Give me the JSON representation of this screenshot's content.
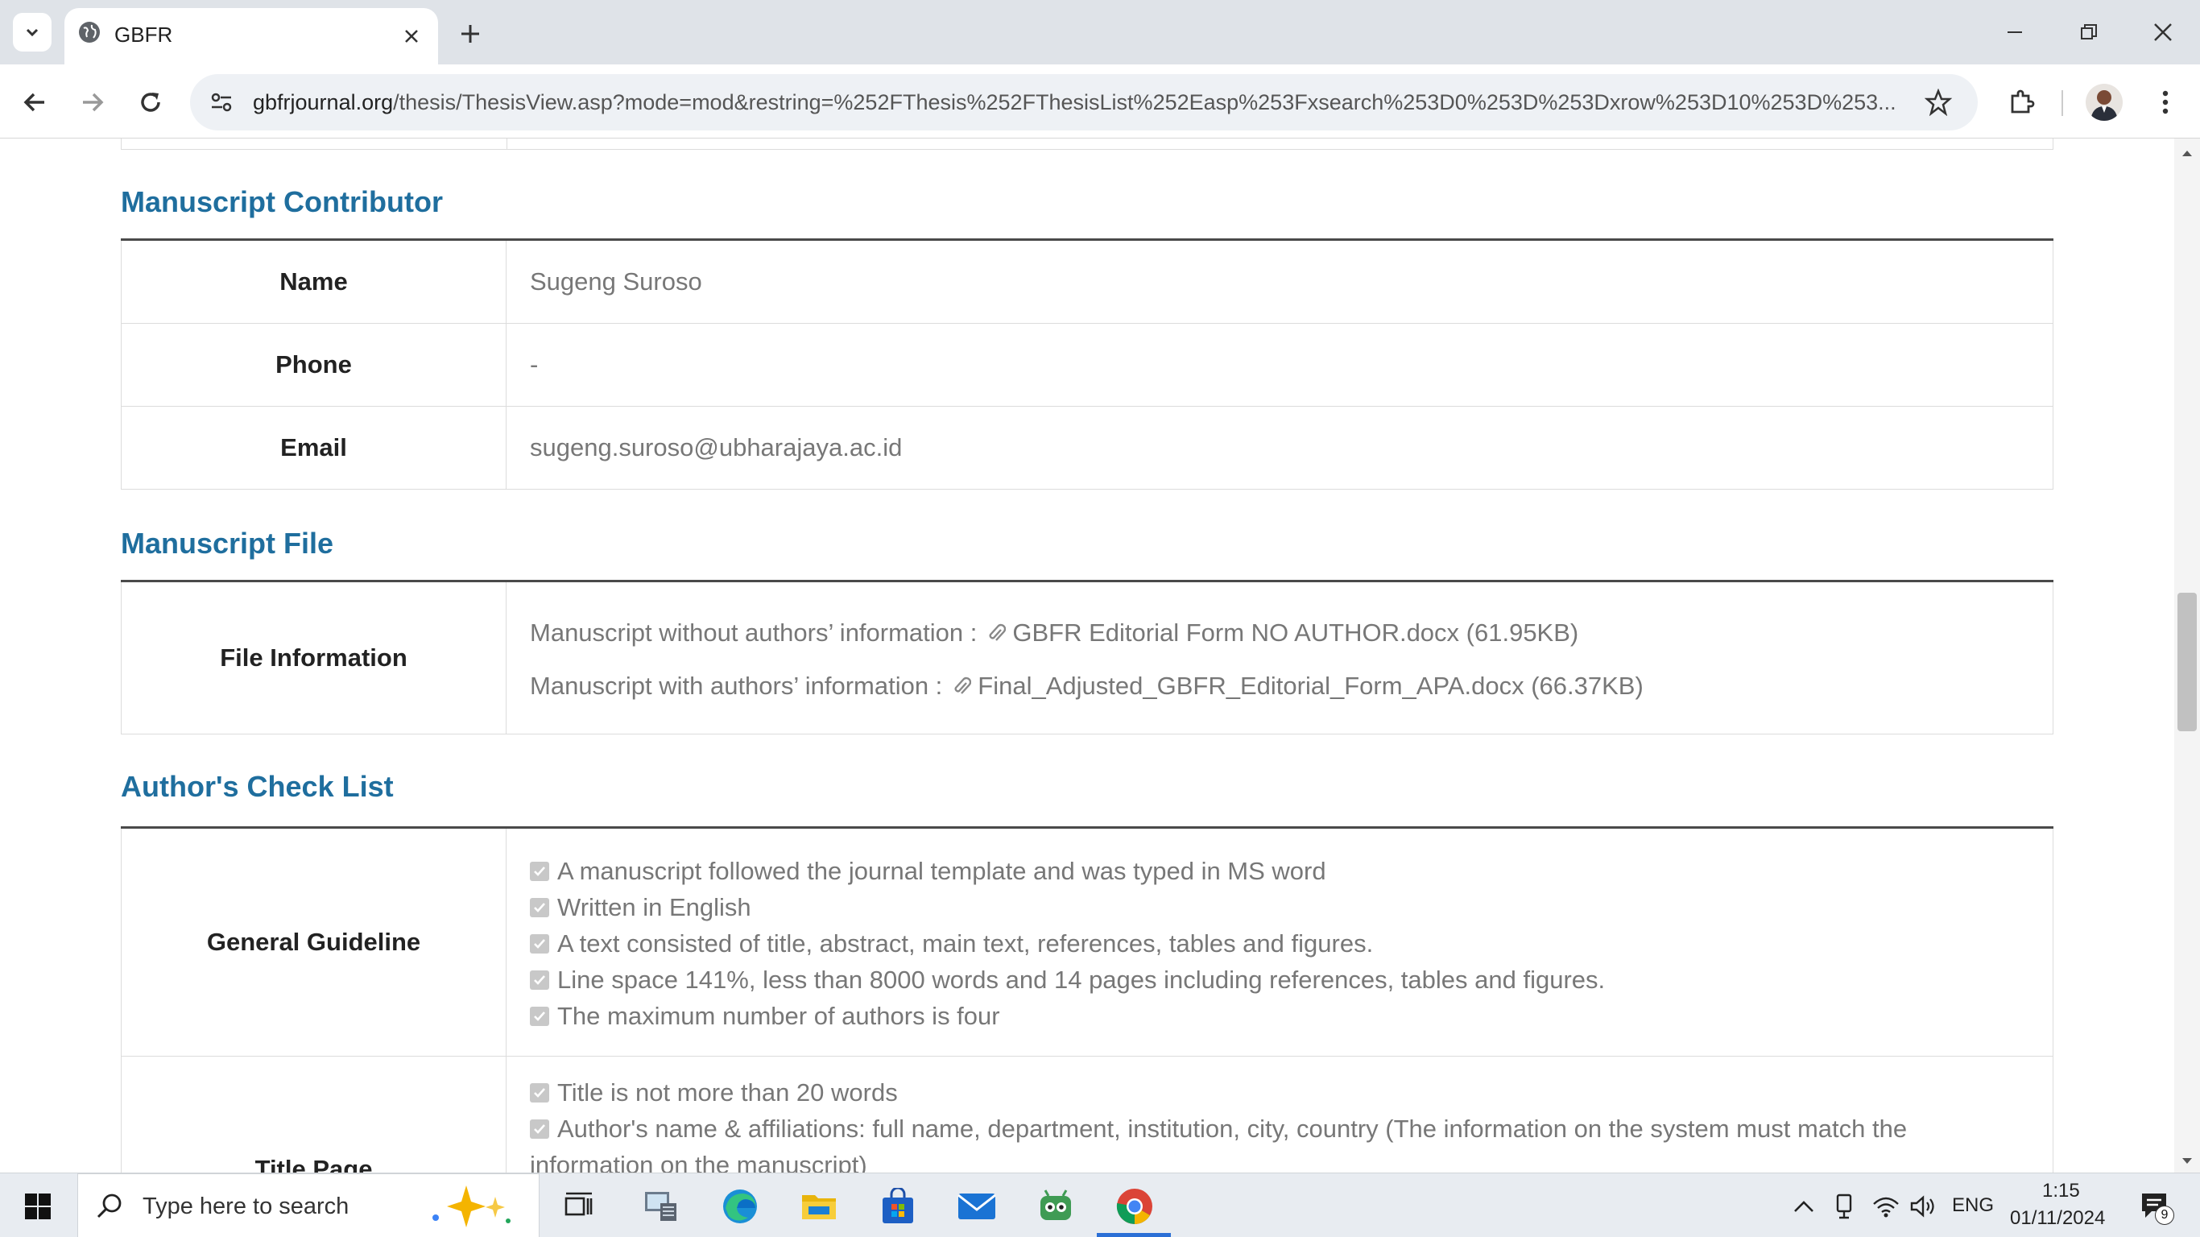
{
  "browser": {
    "tab_title": "GBFR",
    "url_host": "gbfrjournal.org",
    "url_path": "/thesis/ThesisView.asp?mode=mod&restring=%252FThesis%252FThesisList%252Easp%253Fxsearch%253D0%253D%253Dxrow%253D10%253D%253..."
  },
  "sections": {
    "contributor": {
      "title": "Manuscript Contributor",
      "rows": [
        {
          "label": "Name",
          "value": "Sugeng Suroso"
        },
        {
          "label": "Phone",
          "value": "-"
        },
        {
          "label": "Email",
          "value": "sugeng.suroso@ubharajaya.ac.id"
        }
      ]
    },
    "file": {
      "title": "Manuscript File",
      "label": "File Information",
      "lines": [
        {
          "prefix": "Manuscript without authors’ information : ",
          "file": "GBFR Editorial Form NO AUTHOR.docx (61.95KB)"
        },
        {
          "prefix": "Manuscript with authors’ information : ",
          "file": "Final_Adjusted_GBFR_Editorial_Form_APA.docx (66.37KB)"
        }
      ]
    },
    "checklist": {
      "title": "Author's Check List",
      "general": {
        "label": "General Guideline",
        "items": [
          "A manuscript followed the journal template and was typed in MS word",
          "Written in English",
          "A text consisted of title, abstract, main text, references, tables and figures.",
          "Line space 141%, less than 8000 words and 14 pages including references, tables and figures.",
          "The maximum number of authors is four"
        ]
      },
      "title_page": {
        "label": "Title Page",
        "items": [
          "Title is not more than 20 words",
          "Author's name & affiliations: full name, department, institution, city, country (The information on the system must match the",
          "information on the manuscript)"
        ]
      }
    }
  },
  "taskbar": {
    "search_placeholder": "Type here to search",
    "lang": "ENG",
    "time": "1:15",
    "date": "01/11/2024",
    "notifications": "9"
  },
  "colors": {
    "heading": "#1f6e9e",
    "value_text": "#777777",
    "accent": "#2b6fd6"
  }
}
